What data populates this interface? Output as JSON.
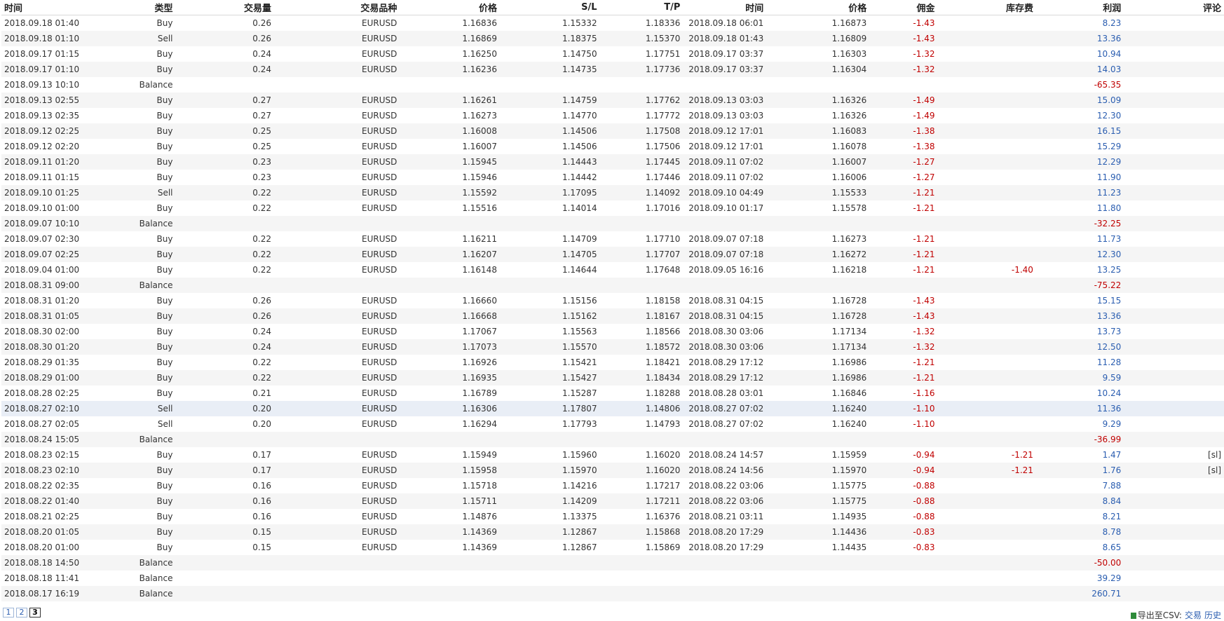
{
  "headers": [
    "时间",
    "类型",
    "交易量",
    "交易品种",
    "价格",
    "S/L",
    "T/P",
    "时间",
    "价格",
    "佣金",
    "库存费",
    "利润",
    "评论"
  ],
  "rows": [
    [
      "2018.09.18 01:40",
      "Buy",
      "0.26",
      "EURUSD",
      "1.16836",
      "1.15332",
      "1.18336",
      "2018.09.18 06:01",
      "1.16873",
      "-1.43",
      "",
      "8.23",
      ""
    ],
    [
      "2018.09.18 01:10",
      "Sell",
      "0.26",
      "EURUSD",
      "1.16869",
      "1.18375",
      "1.15370",
      "2018.09.18 01:43",
      "1.16809",
      "-1.43",
      "",
      "13.36",
      ""
    ],
    [
      "2018.09.17 01:15",
      "Buy",
      "0.24",
      "EURUSD",
      "1.16250",
      "1.14750",
      "1.17751",
      "2018.09.17 03:37",
      "1.16303",
      "-1.32",
      "",
      "10.94",
      ""
    ],
    [
      "2018.09.17 01:10",
      "Buy",
      "0.24",
      "EURUSD",
      "1.16236",
      "1.14735",
      "1.17736",
      "2018.09.17 03:37",
      "1.16304",
      "-1.32",
      "",
      "14.03",
      ""
    ],
    [
      "2018.09.13 10:10",
      "Balance",
      "",
      "",
      "",
      "",
      "",
      "",
      "",
      "",
      "",
      "-65.35",
      ""
    ],
    [
      "2018.09.13 02:55",
      "Buy",
      "0.27",
      "EURUSD",
      "1.16261",
      "1.14759",
      "1.17762",
      "2018.09.13 03:03",
      "1.16326",
      "-1.49",
      "",
      "15.09",
      ""
    ],
    [
      "2018.09.13 02:35",
      "Buy",
      "0.27",
      "EURUSD",
      "1.16273",
      "1.14770",
      "1.17772",
      "2018.09.13 03:03",
      "1.16326",
      "-1.49",
      "",
      "12.30",
      ""
    ],
    [
      "2018.09.12 02:25",
      "Buy",
      "0.25",
      "EURUSD",
      "1.16008",
      "1.14506",
      "1.17508",
      "2018.09.12 17:01",
      "1.16083",
      "-1.38",
      "",
      "16.15",
      ""
    ],
    [
      "2018.09.12 02:20",
      "Buy",
      "0.25",
      "EURUSD",
      "1.16007",
      "1.14506",
      "1.17506",
      "2018.09.12 17:01",
      "1.16078",
      "-1.38",
      "",
      "15.29",
      ""
    ],
    [
      "2018.09.11 01:20",
      "Buy",
      "0.23",
      "EURUSD",
      "1.15945",
      "1.14443",
      "1.17445",
      "2018.09.11 07:02",
      "1.16007",
      "-1.27",
      "",
      "12.29",
      ""
    ],
    [
      "2018.09.11 01:15",
      "Buy",
      "0.23",
      "EURUSD",
      "1.15946",
      "1.14442",
      "1.17446",
      "2018.09.11 07:02",
      "1.16006",
      "-1.27",
      "",
      "11.90",
      ""
    ],
    [
      "2018.09.10 01:25",
      "Sell",
      "0.22",
      "EURUSD",
      "1.15592",
      "1.17095",
      "1.14092",
      "2018.09.10 04:49",
      "1.15533",
      "-1.21",
      "",
      "11.23",
      ""
    ],
    [
      "2018.09.10 01:00",
      "Buy",
      "0.22",
      "EURUSD",
      "1.15516",
      "1.14014",
      "1.17016",
      "2018.09.10 01:17",
      "1.15578",
      "-1.21",
      "",
      "11.80",
      ""
    ],
    [
      "2018.09.07 10:10",
      "Balance",
      "",
      "",
      "",
      "",
      "",
      "",
      "",
      "",
      "",
      "-32.25",
      ""
    ],
    [
      "2018.09.07 02:30",
      "Buy",
      "0.22",
      "EURUSD",
      "1.16211",
      "1.14709",
      "1.17710",
      "2018.09.07 07:18",
      "1.16273",
      "-1.21",
      "",
      "11.73",
      ""
    ],
    [
      "2018.09.07 02:25",
      "Buy",
      "0.22",
      "EURUSD",
      "1.16207",
      "1.14705",
      "1.17707",
      "2018.09.07 07:18",
      "1.16272",
      "-1.21",
      "",
      "12.30",
      ""
    ],
    [
      "2018.09.04 01:00",
      "Buy",
      "0.22",
      "EURUSD",
      "1.16148",
      "1.14644",
      "1.17648",
      "2018.09.05 16:16",
      "1.16218",
      "-1.21",
      "-1.40",
      "13.25",
      ""
    ],
    [
      "2018.08.31 09:00",
      "Balance",
      "",
      "",
      "",
      "",
      "",
      "",
      "",
      "",
      "",
      "-75.22",
      ""
    ],
    [
      "2018.08.31 01:20",
      "Buy",
      "0.26",
      "EURUSD",
      "1.16660",
      "1.15156",
      "1.18158",
      "2018.08.31 04:15",
      "1.16728",
      "-1.43",
      "",
      "15.15",
      ""
    ],
    [
      "2018.08.31 01:05",
      "Buy",
      "0.26",
      "EURUSD",
      "1.16668",
      "1.15162",
      "1.18167",
      "2018.08.31 04:15",
      "1.16728",
      "-1.43",
      "",
      "13.36",
      ""
    ],
    [
      "2018.08.30 02:00",
      "Buy",
      "0.24",
      "EURUSD",
      "1.17067",
      "1.15563",
      "1.18566",
      "2018.08.30 03:06",
      "1.17134",
      "-1.32",
      "",
      "13.73",
      ""
    ],
    [
      "2018.08.30 01:20",
      "Buy",
      "0.24",
      "EURUSD",
      "1.17073",
      "1.15570",
      "1.18572",
      "2018.08.30 03:06",
      "1.17134",
      "-1.32",
      "",
      "12.50",
      ""
    ],
    [
      "2018.08.29 01:35",
      "Buy",
      "0.22",
      "EURUSD",
      "1.16926",
      "1.15421",
      "1.18421",
      "2018.08.29 17:12",
      "1.16986",
      "-1.21",
      "",
      "11.28",
      ""
    ],
    [
      "2018.08.29 01:00",
      "Buy",
      "0.22",
      "EURUSD",
      "1.16935",
      "1.15427",
      "1.18434",
      "2018.08.29 17:12",
      "1.16986",
      "-1.21",
      "",
      "9.59",
      ""
    ],
    [
      "2018.08.28 02:25",
      "Buy",
      "0.21",
      "EURUSD",
      "1.16789",
      "1.15287",
      "1.18288",
      "2018.08.28 03:01",
      "1.16846",
      "-1.16",
      "",
      "10.24",
      ""
    ],
    [
      "2018.08.27 02:10",
      "Sell",
      "0.20",
      "EURUSD",
      "1.16306",
      "1.17807",
      "1.14806",
      "2018.08.27 07:02",
      "1.16240",
      "-1.10",
      "",
      "11.36",
      ""
    ],
    [
      "2018.08.27 02:05",
      "Sell",
      "0.20",
      "EURUSD",
      "1.16294",
      "1.17793",
      "1.14793",
      "2018.08.27 07:02",
      "1.16240",
      "-1.10",
      "",
      "9.29",
      ""
    ],
    [
      "2018.08.24 15:05",
      "Balance",
      "",
      "",
      "",
      "",
      "",
      "",
      "",
      "",
      "",
      "-36.99",
      ""
    ],
    [
      "2018.08.23 02:15",
      "Buy",
      "0.17",
      "EURUSD",
      "1.15949",
      "1.15960",
      "1.16020",
      "2018.08.24 14:57",
      "1.15959",
      "-0.94",
      "-1.21",
      "1.47",
      "[sl]"
    ],
    [
      "2018.08.23 02:10",
      "Buy",
      "0.17",
      "EURUSD",
      "1.15958",
      "1.15970",
      "1.16020",
      "2018.08.24 14:56",
      "1.15970",
      "-0.94",
      "-1.21",
      "1.76",
      "[sl]"
    ],
    [
      "2018.08.22 02:35",
      "Buy",
      "0.16",
      "EURUSD",
      "1.15718",
      "1.14216",
      "1.17217",
      "2018.08.22 03:06",
      "1.15775",
      "-0.88",
      "",
      "7.88",
      ""
    ],
    [
      "2018.08.22 01:40",
      "Buy",
      "0.16",
      "EURUSD",
      "1.15711",
      "1.14209",
      "1.17211",
      "2018.08.22 03:06",
      "1.15775",
      "-0.88",
      "",
      "8.84",
      ""
    ],
    [
      "2018.08.21 02:25",
      "Buy",
      "0.16",
      "EURUSD",
      "1.14876",
      "1.13375",
      "1.16376",
      "2018.08.21 03:11",
      "1.14935",
      "-0.88",
      "",
      "8.21",
      ""
    ],
    [
      "2018.08.20 01:05",
      "Buy",
      "0.15",
      "EURUSD",
      "1.14369",
      "1.12867",
      "1.15868",
      "2018.08.20 17:29",
      "1.14436",
      "-0.83",
      "",
      "8.78",
      ""
    ],
    [
      "2018.08.20 01:00",
      "Buy",
      "0.15",
      "EURUSD",
      "1.14369",
      "1.12867",
      "1.15869",
      "2018.08.20 17:29",
      "1.14435",
      "-0.83",
      "",
      "8.65",
      ""
    ],
    [
      "2018.08.18 14:50",
      "Balance",
      "",
      "",
      "",
      "",
      "",
      "",
      "",
      "",
      "",
      "-50.00",
      ""
    ],
    [
      "2018.08.18 11:41",
      "Balance",
      "",
      "",
      "",
      "",
      "",
      "",
      "",
      "",
      "",
      "39.29",
      ""
    ],
    [
      "2018.08.17 16:19",
      "Balance",
      "",
      "",
      "",
      "",
      "",
      "",
      "",
      "",
      "",
      "260.71",
      ""
    ]
  ],
  "highlight_row": 25,
  "pagination": {
    "pages": [
      "1",
      "2",
      "3"
    ],
    "current": "3"
  },
  "export": {
    "label": "导出至CSV:",
    "links": [
      "交易",
      "历史"
    ]
  },
  "colors": {
    "negative": "#c00000",
    "positive": "#2a5db0",
    "stripe": "#f5f5f5",
    "highlight": "#e9eef6"
  }
}
